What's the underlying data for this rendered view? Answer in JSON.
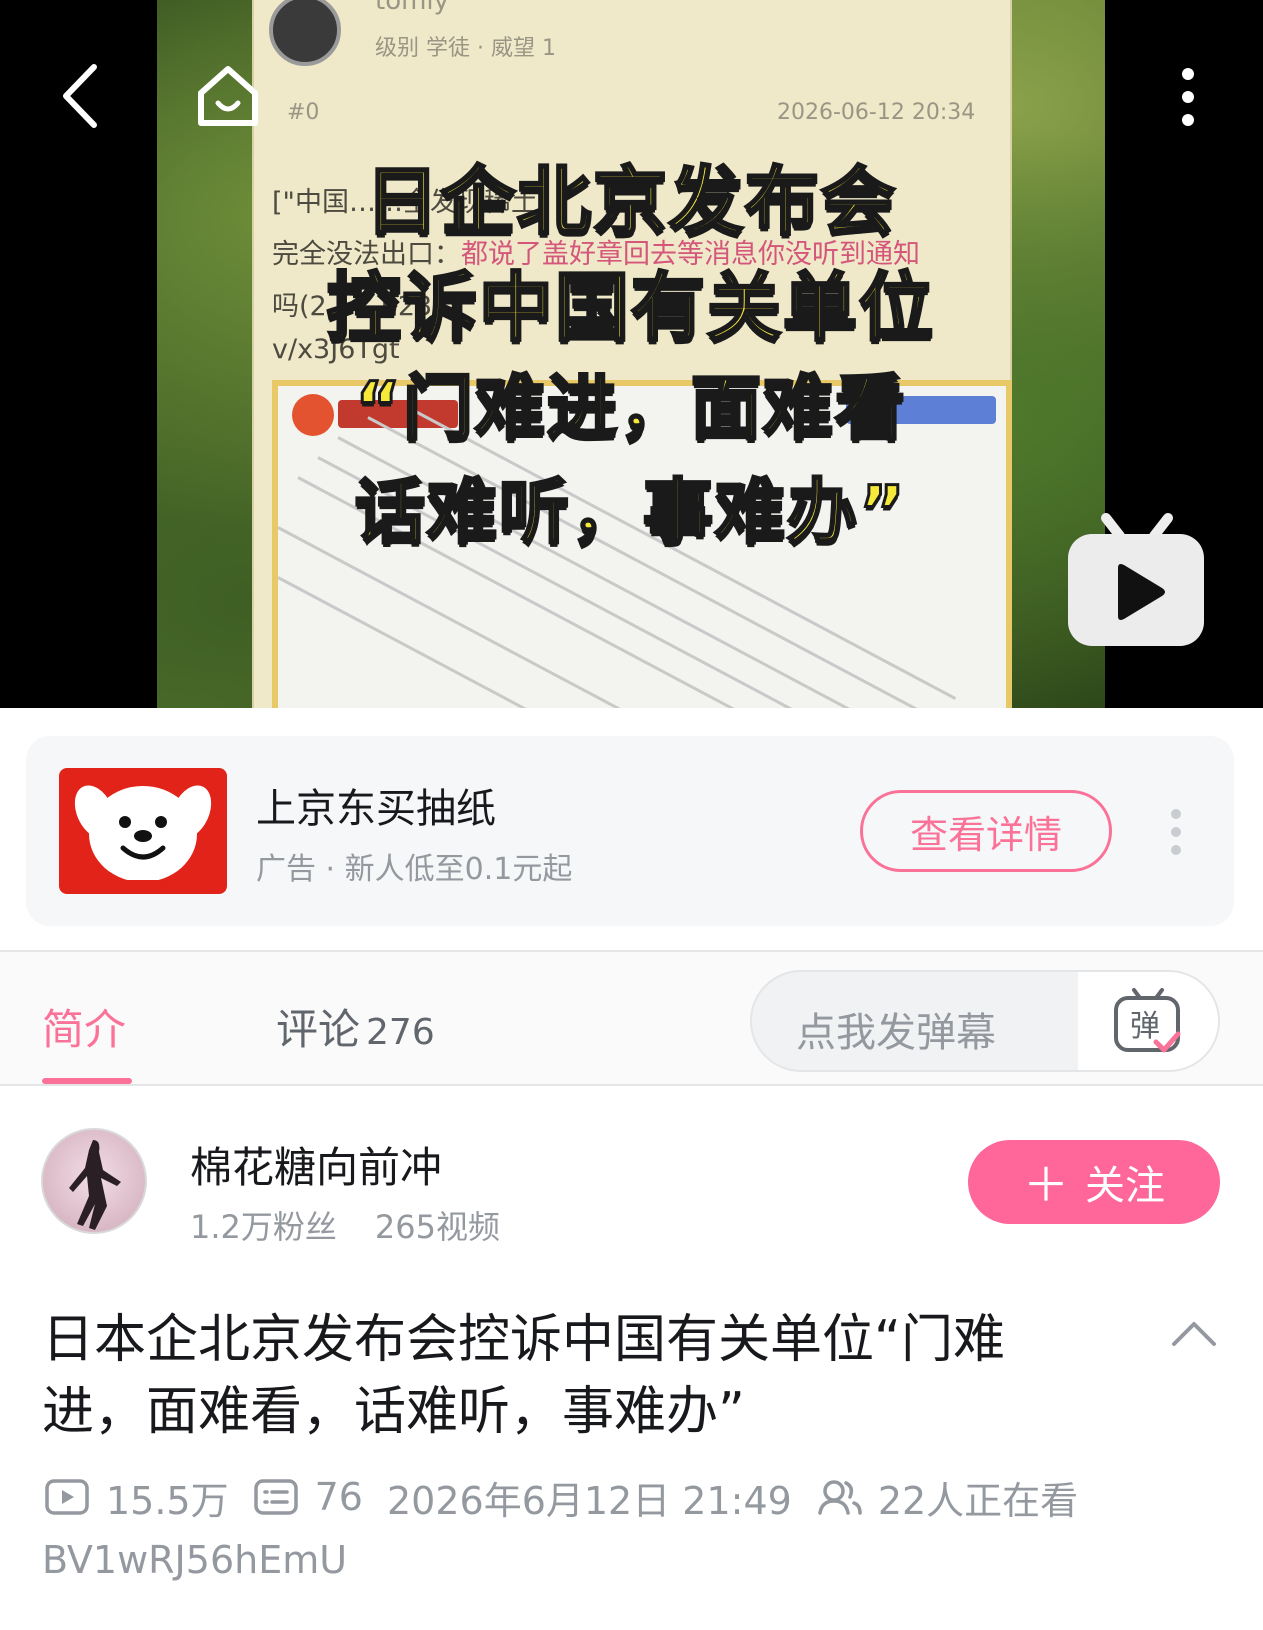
{
  "player": {
    "post": {
      "username": "tomiy",
      "level_line": "级别 学徒 · 威望 1",
      "floor": "#0",
      "timestamp": "2026-06-12 20:34",
      "body_line1": "[\"中国……全发现稀土",
      "body_line2_a": "完全没法出口：",
      "body_line2_b": "都说了盖好章回去等消息你没听到通知",
      "body_line3": "吗(2……b23.t",
      "body_line4": "v/x3J6Tgt"
    },
    "overlay": {
      "line1": "日企北京发布会",
      "line2": "控诉中国有关单位",
      "line3": "“门难进，面难看",
      "line4": "话难听，事难办”"
    }
  },
  "ad": {
    "title": "上京东买抽纸",
    "subtitle": "广告 · 新人低至0.1元起",
    "button": "查看详情",
    "brand_color": "#e2231a"
  },
  "tabs": {
    "intro": "简介",
    "comments": "评论",
    "comment_count": "276",
    "danmaku_placeholder": "点我发弹幕",
    "danmaku_icon_label": "弹"
  },
  "author": {
    "name": "棉花糖向前冲",
    "fans": "1.2万粉丝",
    "videos": "265视频",
    "follow_label": "关注"
  },
  "video": {
    "title": "日本企北京发布会控诉中国有关单位“门难进，面难看，话难听，事难办”",
    "views": "15.5万",
    "danmaku_count": "76",
    "date": "2026年6月12日 21:49",
    "watching": "22人正在看",
    "bvid": "BV1wRJ56hEmU"
  },
  "colors": {
    "accent": "#fb7299",
    "follow_bg": "#ff6699",
    "secondary_text": "#9499a0"
  }
}
